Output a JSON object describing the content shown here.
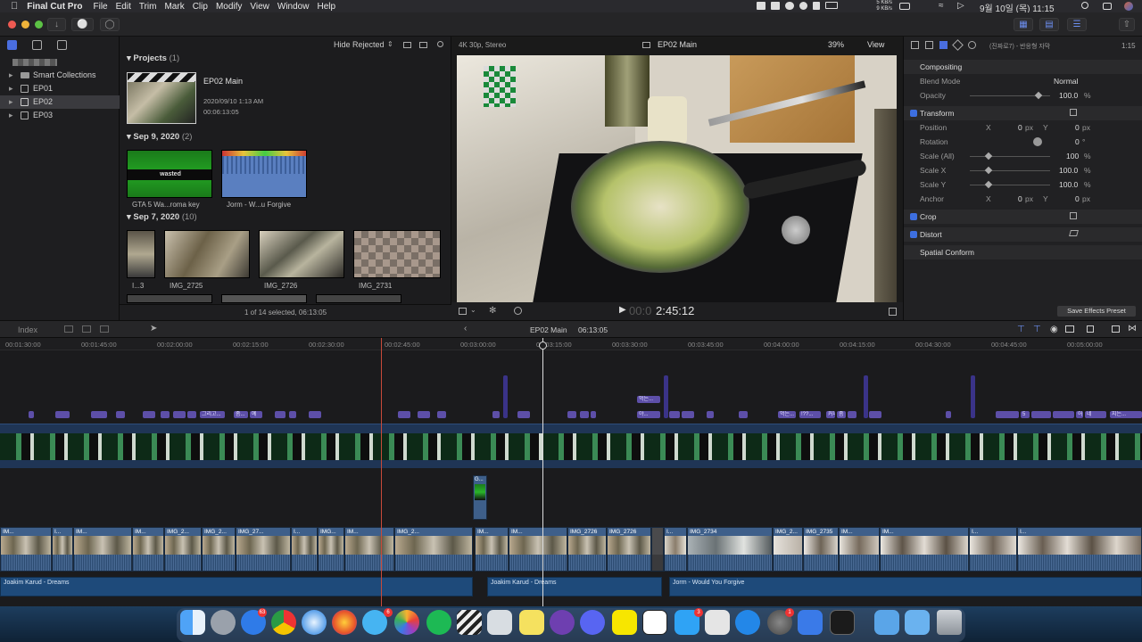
{
  "menubar": {
    "app_name": "Final Cut Pro",
    "items": [
      "File",
      "Edit",
      "Trim",
      "Mark",
      "Clip",
      "Modify",
      "View",
      "Window",
      "Help"
    ],
    "net_up": "5 KB/s",
    "net_down": "9 KB/s",
    "datetime": "9월 10일 (목)  11:15"
  },
  "library": {
    "items": [
      {
        "label": "Smart Collections",
        "selected": false
      },
      {
        "label": "EP01",
        "selected": false
      },
      {
        "label": "EP02",
        "selected": true
      },
      {
        "label": "EP03",
        "selected": false
      }
    ]
  },
  "browser": {
    "filter": "Hide Rejected",
    "projects_header": "Projects",
    "projects_count": "(1)",
    "project": {
      "title": "EP02 Main",
      "date": "2020/09/10 1:13 AM",
      "duration": "00:06:13:05"
    },
    "group1_header": "Sep 9, 2020",
    "group1_count": "(2)",
    "group1_clips": [
      "GTA 5 Wa...roma key",
      "Jorm - W...u Forgive"
    ],
    "wasted_text": "wasted",
    "group2_header": "Sep 7, 2020",
    "group2_count": "(10)",
    "group2_clips": [
      "I...3",
      "IMG_2725",
      "IMG_2726",
      "IMG_2731"
    ],
    "status": "1 of 14 selected, 06:13:05"
  },
  "viewer": {
    "format": "4K 30p, Stereo",
    "title": "EP02 Main",
    "zoom": "39%",
    "view_label": "View",
    "timecode_dim": "00:0",
    "timecode": "2:45:12"
  },
  "inspector": {
    "clip_name": "(진짜로7) - 반응형 자막",
    "clip_time": "1:15",
    "compositing": "Compositing",
    "blend_mode_label": "Blend Mode",
    "blend_mode_value": "Normal",
    "opacity_label": "Opacity",
    "opacity_value": "100.0",
    "opacity_unit": "%",
    "transform": "Transform",
    "position_label": "Position",
    "position_x": "0",
    "position_y": "0",
    "px": "px",
    "rotation_label": "Rotation",
    "rotation_value": "0",
    "deg": "°",
    "scale_all_label": "Scale (All)",
    "scale_all": "100",
    "scale_x_label": "Scale X",
    "scale_x": "100.0",
    "scale_y_label": "Scale Y",
    "scale_y": "100.0",
    "anchor_label": "Anchor",
    "anchor_x": "0",
    "anchor_y": "0",
    "x": "X",
    "y": "Y",
    "crop": "Crop",
    "distort": "Distort",
    "spatial_conform": "Spatial Conform",
    "save_preset": "Save Effects Preset"
  },
  "timeline_bar": {
    "index": "Index",
    "project": "EP02 Main",
    "duration": "06:13:05"
  },
  "ruler": [
    "00:01:30:00",
    "00:01:45:00",
    "00:02:00:00",
    "00:02:15:00",
    "00:02:30:00",
    "00:02:45:00",
    "00:03:00:00",
    "00:03:15:00",
    "00:03:30:00",
    "00:03:45:00",
    "00:04:00:00",
    "00:04:15:00",
    "00:04:30:00",
    "00:04:45:00",
    "00:05:00:00"
  ],
  "labels_row": [
    "그리고...",
    "좀...",
    "예",
    "야...",
    "먹는...",
    "!??...",
    "커피...",
    "좀",
    "5",
    "어",
    "네",
    "지는..."
  ],
  "mid_label": "먹는...",
  "connected_clip": "G...",
  "clips": [
    "IM...",
    "I...",
    "IM...",
    "IM...",
    "IMG_2...",
    "IMG_2...",
    "IMG_27...",
    "I...",
    "IMG...",
    "IM...",
    "IMG_2...",
    "IM...",
    "IM...",
    "IMG_2726",
    "I...",
    "IMG_2734",
    "IMG_2...",
    "IMG_2735",
    "IM...",
    "IM...",
    "I...",
    "I..."
  ],
  "audio": [
    "Joakim Karud - Dreams",
    "Joakim Karud - Dreams",
    "Jorm - Would You Forgive"
  ],
  "dock_badges": [
    "63",
    "6",
    "3",
    "1"
  ],
  "colors": {
    "accent": "#3d6fe0",
    "label": "#5d4fa8",
    "clip": "#3e5f8a",
    "audio": "#1e4a7a",
    "playhead": "#c84a3a"
  }
}
